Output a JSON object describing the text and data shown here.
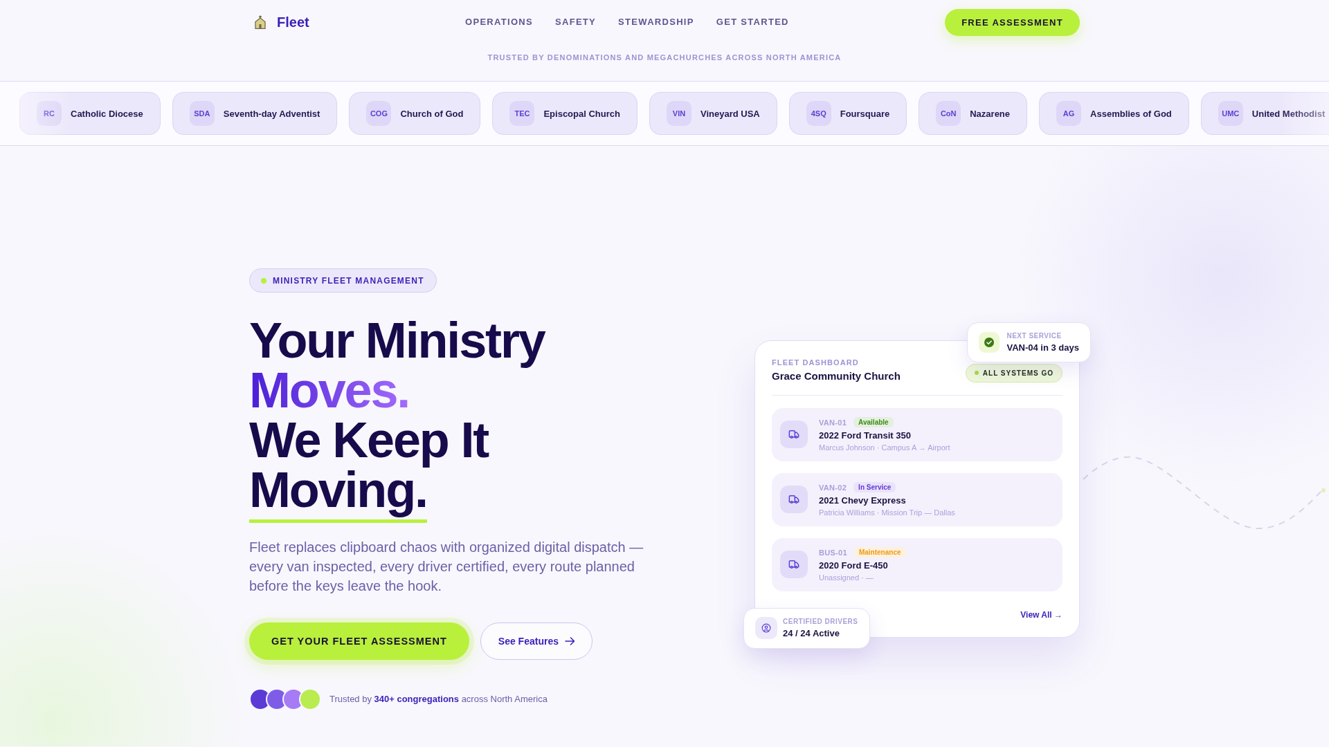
{
  "header": {
    "logo": {
      "text": "Fleet"
    },
    "nav": [
      {
        "label": "OPERATIONS"
      },
      {
        "label": "SAFETY"
      },
      {
        "label": "STEWARDSHIP"
      },
      {
        "label": "GET STARTED"
      }
    ],
    "cta": "FREE ASSESSMENT"
  },
  "trusted_banner": {
    "caption": "TRUSTED BY DENOMINATIONS AND MEGACHURCHES ACROSS NORTH AMERICA",
    "denominations": [
      {
        "abbr": "RC",
        "name": "Catholic Diocese"
      },
      {
        "abbr": "SDA",
        "name": "Seventh-day Adventist"
      },
      {
        "abbr": "COG",
        "name": "Church of God"
      },
      {
        "abbr": "TEC",
        "name": "Episcopal Church"
      },
      {
        "abbr": "VIN",
        "name": "Vineyard USA"
      },
      {
        "abbr": "4SQ",
        "name": "Foursquare"
      },
      {
        "abbr": "CoN",
        "name": "Nazarene"
      },
      {
        "abbr": "AG",
        "name": "Assemblies of God"
      },
      {
        "abbr": "UMC",
        "name": "United Methodist"
      }
    ]
  },
  "hero": {
    "badge": "MINISTRY FLEET MANAGEMENT",
    "headline": [
      {
        "text": "Your Ministry",
        "kind": "plain"
      },
      {
        "text": "Moves.",
        "kind": "gradient"
      },
      {
        "text": "We Keep It",
        "kind": "plain"
      },
      {
        "text": "Moving.",
        "kind": "underlined"
      }
    ],
    "description": "Fleet replaces clipboard chaos with organized digital dispatch — every van inspected, every driver certified, every route planned before the keys leave the hook.",
    "buttons": [
      {
        "label": "GET YOUR FLEET ASSESSMENT",
        "kind": "primary"
      },
      {
        "label": "See Features",
        "kind": "secondary"
      }
    ],
    "trust": {
      "avatars": [
        {
          "color": "#5b3ad6"
        },
        {
          "color": "#7e5ce8"
        },
        {
          "color": "#a67bf6"
        },
        {
          "color": "#b9ec4f"
        }
      ],
      "text": "Trusted by **340+ congregations** across North America"
    }
  },
  "dashboard": {
    "eyebrow": "FLEET DASHBOARD",
    "title": "Grace Community Church",
    "status": "ALL SYSTEMS GO",
    "vehicles": [
      {
        "id": "VAN-01",
        "status": {
          "text": "Available",
          "color": "#3c8a16"
        },
        "name": "2022 Ford Transit 350",
        "detail": "Marcus Johnson · Campus A → Airport"
      },
      {
        "id": "VAN-02",
        "status": {
          "text": "In Service",
          "color": "#6437d9"
        },
        "name": "2021 Chevy Express",
        "detail": "Patricia Williams · Mission Trip — Dallas"
      },
      {
        "id": "BUS-01",
        "status": {
          "text": "Maintenance",
          "color": "#ef9a14"
        },
        "name": "2020 Ford E-450",
        "detail": "Unassigned · —"
      }
    ],
    "link": "View All →",
    "next_service": {
      "label": "NEXT SERVICE",
      "value": "VAN-04 in 3 days"
    },
    "certified_drivers": {
      "label": "CERTIFIED DRIVERS",
      "value": "24 / 24 Active"
    }
  }
}
